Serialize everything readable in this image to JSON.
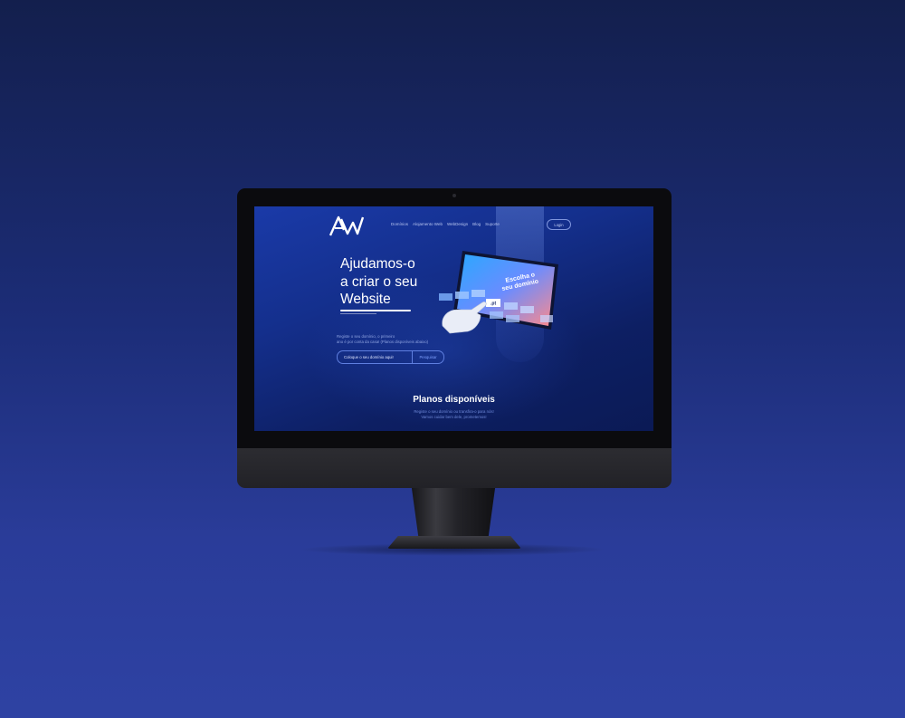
{
  "header": {
    "logo_text": "AW",
    "nav": [
      "Domínios",
      "Alojamento Web",
      "WebDesign",
      "Blog",
      "Suporte"
    ],
    "login_label": "Login"
  },
  "hero": {
    "title_lines": [
      "Ajudamos-o",
      "a criar o seu",
      "Website"
    ],
    "subtitle_lines": [
      "Registe o seu domínio, o primeiro",
      "ano é por conta da casa! (Planos disponíveis abaixo)"
    ],
    "search_placeholder": "Coloque o seu domínio aqui!",
    "search_button": "Pesquisar"
  },
  "illustration": {
    "heading_lines": [
      "Escolha o",
      "seu domínio"
    ],
    "selected_tld": ".pt"
  },
  "plans": {
    "title": "Planos disponíveis",
    "subtitle_lines": [
      "Registe o seu domínio ou transfira-o para nós!",
      "Vamos cuidar bem dele, prometemos!"
    ]
  },
  "colors": {
    "background": "#1c2d78",
    "screen": "#142f8c",
    "accent": "#5f7fe0"
  }
}
